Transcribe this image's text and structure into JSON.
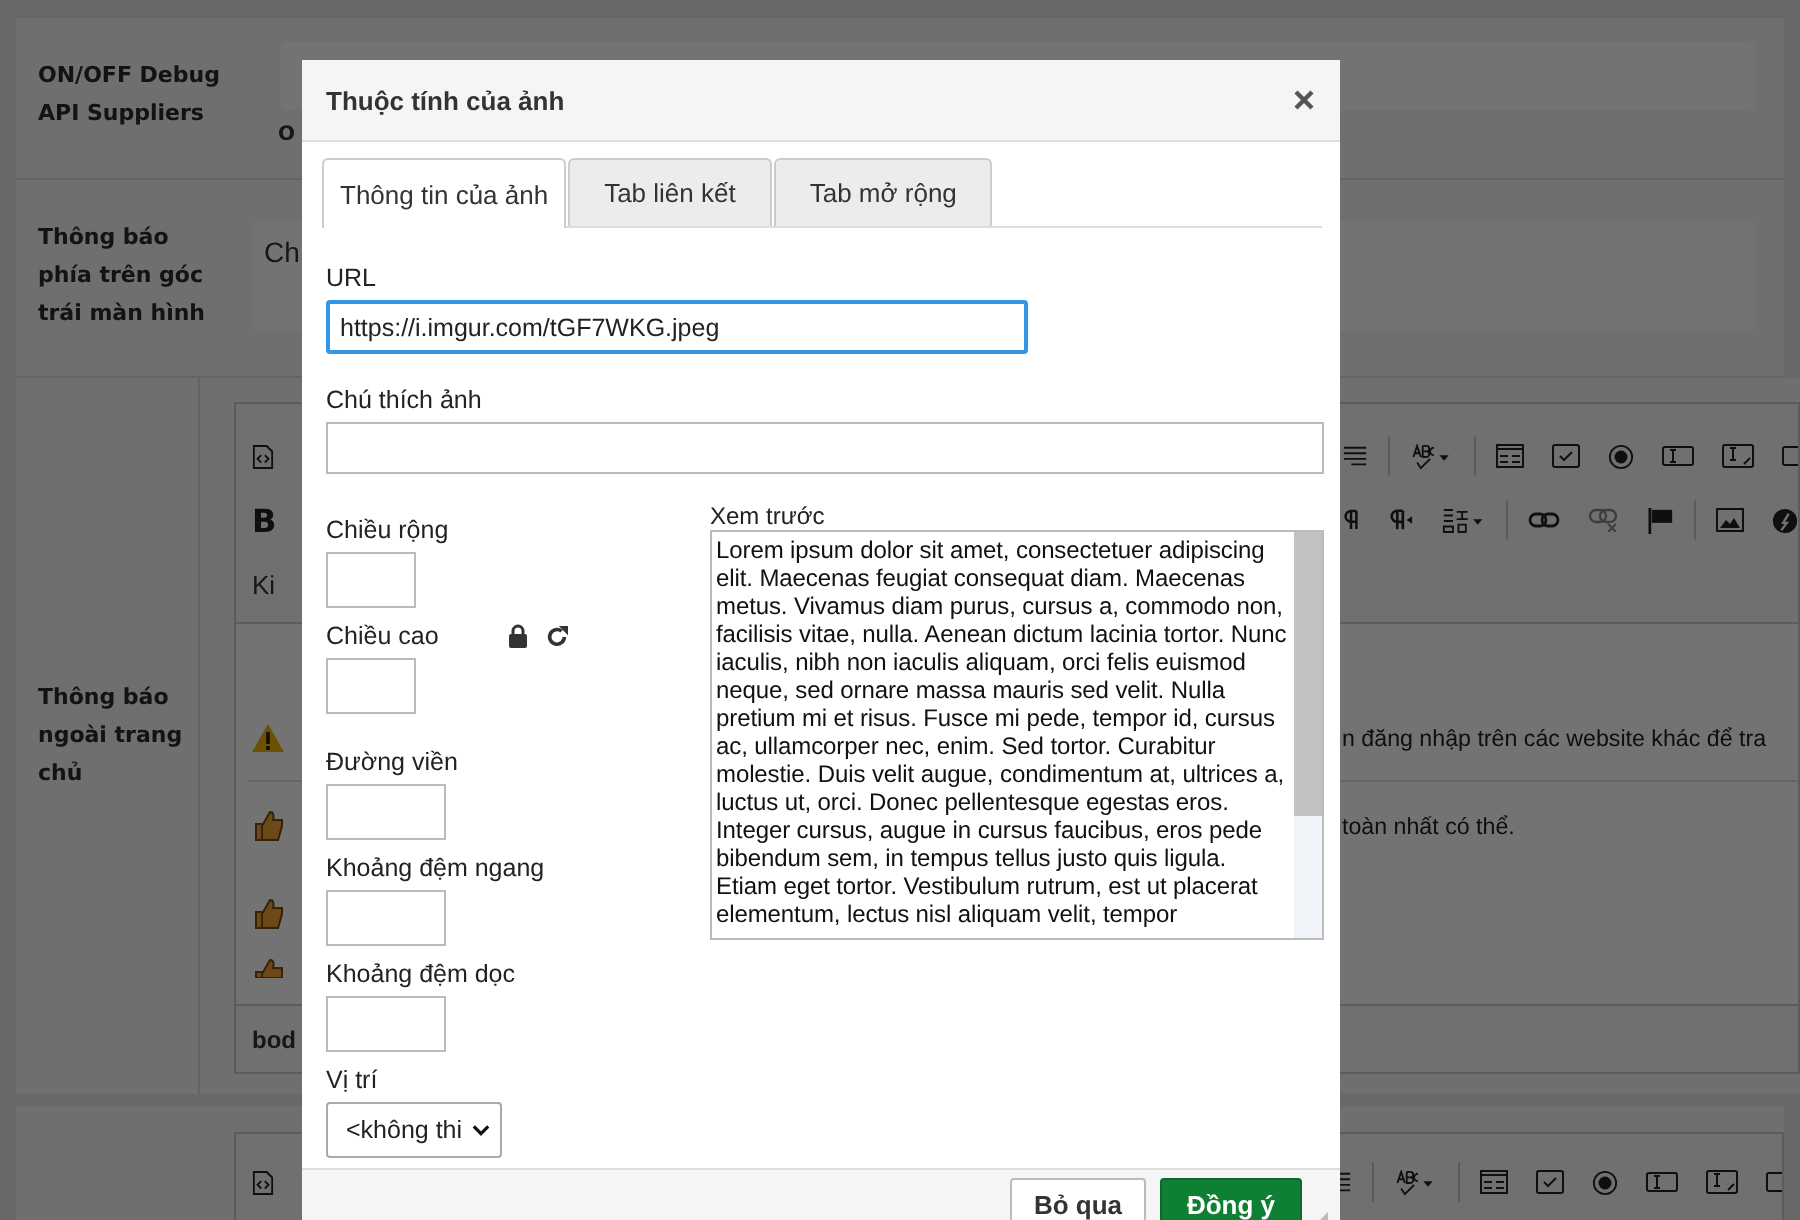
{
  "page_rows": [
    {
      "kind": "toggle",
      "label": "ON/OFF Debug API Suppliers",
      "text": "O"
    },
    {
      "kind": "textbox",
      "label": "Thông báo phía trên góc trái màn hình",
      "text": "Ch"
    },
    {
      "kind": "editor",
      "label": "Thông báo ngoài trang chủ",
      "bold_key": "B",
      "style_menu": "Ki",
      "lines": [
        "n đăng nhập trên các website khác để tra",
        "toàn nhất có thể."
      ],
      "footer": "bod"
    },
    {
      "kind": "editor_top"
    }
  ],
  "dialog": {
    "title": "Thuộc tính của ảnh",
    "tabs": [
      {
        "label": "Thông tin của ảnh",
        "selected": true
      },
      {
        "label": "Tab liên kết",
        "selected": false
      },
      {
        "label": "Tab mở rộng",
        "selected": false
      }
    ],
    "url": {
      "label": "URL",
      "value": "https://i.imgur.com/tGF7WKG.jpeg"
    },
    "caption": {
      "label": "Chú thích ảnh"
    },
    "width": {
      "label": "Chiều rộng"
    },
    "height": {
      "label": "Chiều cao"
    },
    "border": {
      "label": "Đường viền"
    },
    "hspace": {
      "label": "Khoảng đệm ngang"
    },
    "vspace": {
      "label": "Khoảng đệm dọc"
    },
    "align": {
      "label": "Vị trí",
      "value": "<không thi"
    },
    "preview": {
      "label": "Xem trước",
      "text": "Lorem ipsum dolor sit amet, consectetuer adipiscing elit. Maecenas feugiat consequat diam. Maecenas metus. Vivamus diam purus, cursus a, commodo non, facilisis vitae, nulla. Aenean dictum lacinia tortor. Nunc iaculis, nibh non iaculis aliquam, orci felis euismod neque, sed ornare massa mauris sed velit. Nulla pretium mi et risus. Fusce mi pede, tempor id, cursus ac, ullamcorper nec, enim. Sed tortor. Curabitur molestie. Duis velit augue, condimentum at, ultrices a, luctus ut, orci. Donec pellentesque egestas eros. Integer cursus, augue in cursus faucibus, eros pede bibendum sem, in tempus tellus justo quis ligula. Etiam eget tortor. Vestibulum rutrum, est ut placerat elementum, lectus nisl aliquam velit, tempor"
    },
    "buttons": [
      {
        "label": "Bỏ qua",
        "kind": "secondary"
      },
      {
        "label": "Đồng ý",
        "kind": "primary"
      }
    ]
  }
}
